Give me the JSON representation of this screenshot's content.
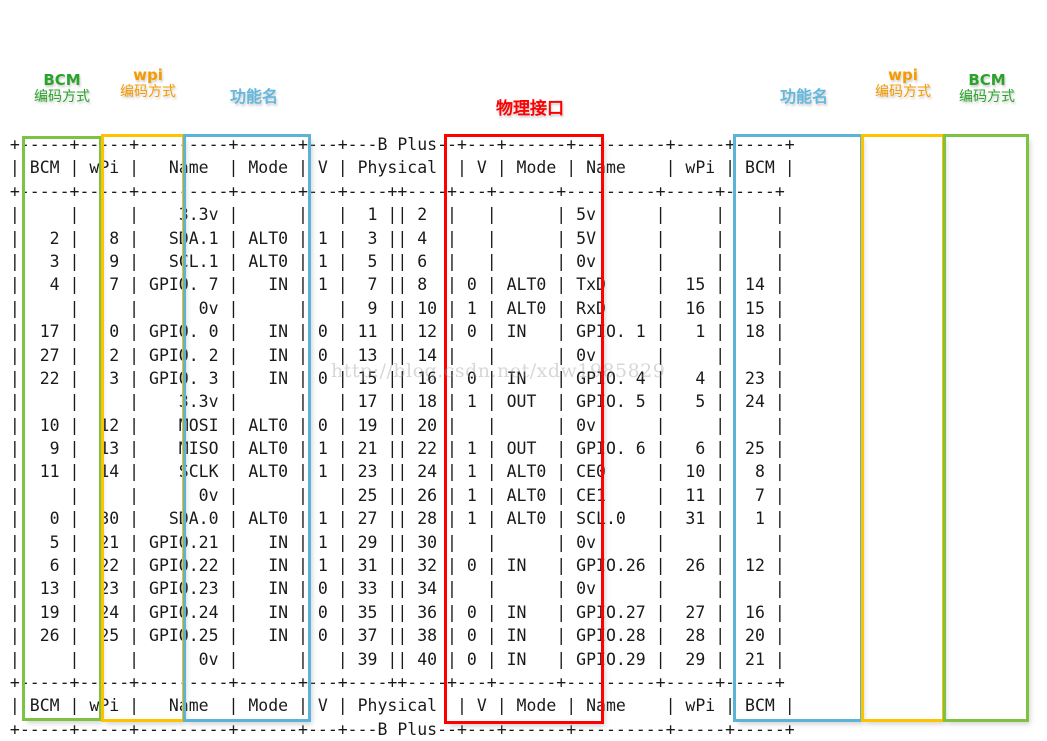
{
  "annotations": {
    "bcm_left": {
      "title": "BCM",
      "subtitle": "编码方式",
      "color": "#2aa32a"
    },
    "wpi_left": {
      "title": "wpi",
      "subtitle": "编码方式",
      "color": "#f59b00"
    },
    "name_left": {
      "title": "功能名",
      "subtitle": "",
      "color": "#63b8de"
    },
    "physical": {
      "title": "物理接口",
      "subtitle": "",
      "color": "#ff0000"
    },
    "name_right": {
      "title": "功能名",
      "subtitle": "",
      "color": "#63b8de"
    },
    "wpi_right": {
      "title": "wpi",
      "subtitle": "编码方式",
      "color": "#f59b00"
    },
    "bcm_right": {
      "title": "BCM",
      "subtitle": "编码方式",
      "color": "#2aa32a"
    }
  },
  "watermark": "http://blog.csdn.net/xdw1985829",
  "board_label": "B Plus",
  "columns": [
    "BCM",
    "wPi",
    "Name",
    "Mode",
    "V",
    "Physical",
    "V",
    "Mode",
    "Name",
    "wPi",
    "BCM"
  ],
  "table_text": [
    " +-----+-----+---------+------+---+---B Plus--+---+------+---------+-----+-----+",
    " | BCM | wPi |   Name  | Mode | V | Physical  | V | Mode | Name    | wPi | BCM |",
    " +-----+-----+---------+------+---+----++----+---+------+---------+-----+-----+",
    " |     |     |    3.3v |      |   |  1 || 2  |   |      | 5v      |     |     |",
    " |   2 |   8 |   SDA.1 | ALT0 | 1 |  3 || 4  |   |      | 5V      |     |     |",
    " |   3 |   9 |   SCL.1 | ALT0 | 1 |  5 || 6  |   |      | 0v      |     |     |",
    " |   4 |   7 | GPIO. 7 |   IN | 1 |  7 || 8  | 0 | ALT0 | TxD     |  15 |  14 |",
    " |     |     |      0v |      |   |  9 || 10 | 1 | ALT0 | RxD     |  16 |  15 |",
    " |  17 |   0 | GPIO. 0 |   IN | 0 | 11 || 12 | 0 | IN   | GPIO. 1 |   1 |  18 |",
    " |  27 |   2 | GPIO. 2 |   IN | 0 | 13 || 14 |   |      | 0v      |     |     |",
    " |  22 |   3 | GPIO. 3 |   IN | 0 | 15 || 16 | 0 | IN   | GPIO. 4 |   4 |  23 |",
    " |     |     |    3.3v |      |   | 17 || 18 | 1 | OUT  | GPIO. 5 |   5 |  24 |",
    " |  10 |  12 |    MOSI | ALT0 | 0 | 19 || 20 |   |      | 0v      |     |     |",
    " |   9 |  13 |    MISO | ALT0 | 1 | 21 || 22 | 1 | OUT  | GPIO. 6 |   6 |  25 |",
    " |  11 |  14 |    SCLK | ALT0 | 1 | 23 || 24 | 1 | ALT0 | CE0     |  10 |   8 |",
    " |     |     |      0v |      |   | 25 || 26 | 1 | ALT0 | CE1     |  11 |   7 |",
    " |   0 |  30 |   SDA.0 | ALT0 | 1 | 27 || 28 | 1 | ALT0 | SCL.0   |  31 |   1 |",
    " |   5 |  21 | GPIO.21 |   IN | 1 | 29 || 30 |   |      | 0v      |     |     |",
    " |   6 |  22 | GPIO.22 |   IN | 1 | 31 || 32 | 0 | IN   | GPIO.26 |  26 |  12 |",
    " |  13 |  23 | GPIO.23 |   IN | 0 | 33 || 34 |   |      | 0v      |     |     |",
    " |  19 |  24 | GPIO.24 |   IN | 0 | 35 || 36 | 0 | IN   | GPIO.27 |  27 |  16 |",
    " |  26 |  25 | GPIO.25 |   IN | 0 | 37 || 38 | 0 | IN   | GPIO.28 |  28 |  20 |",
    " |     |     |      0v |      |   | 39 || 40 | 0 | IN   | GPIO.29 |  29 |  21 |",
    " +-----+-----+---------+------+---+----++----+---+------+---------+-----+-----+",
    " | BCM | wPi |   Name  | Mode | V | Physical  | V | Mode | Name    | wPi | BCM |",
    " +-----+-----+---------+------+---+---B Plus--+---+------+---------+-----+-----+"
  ],
  "rows": [
    {
      "bcm_l": "",
      "wpi_l": "",
      "name_l": "3.3v",
      "mode_l": "",
      "v_l": "",
      "phys_l": "1",
      "phys_r": "2",
      "v_r": "",
      "mode_r": "",
      "name_r": "5v",
      "wpi_r": "",
      "bcm_r": ""
    },
    {
      "bcm_l": "2",
      "wpi_l": "8",
      "name_l": "SDA.1",
      "mode_l": "ALT0",
      "v_l": "1",
      "phys_l": "3",
      "phys_r": "4",
      "v_r": "",
      "mode_r": "",
      "name_r": "5V",
      "wpi_r": "",
      "bcm_r": ""
    },
    {
      "bcm_l": "3",
      "wpi_l": "9",
      "name_l": "SCL.1",
      "mode_l": "ALT0",
      "v_l": "1",
      "phys_l": "5",
      "phys_r": "6",
      "v_r": "",
      "mode_r": "",
      "name_r": "0v",
      "wpi_r": "",
      "bcm_r": ""
    },
    {
      "bcm_l": "4",
      "wpi_l": "7",
      "name_l": "GPIO. 7",
      "mode_l": "IN",
      "v_l": "1",
      "phys_l": "7",
      "phys_r": "8",
      "v_r": "0",
      "mode_r": "ALT0",
      "name_r": "TxD",
      "wpi_r": "15",
      "bcm_r": "14"
    },
    {
      "bcm_l": "",
      "wpi_l": "",
      "name_l": "0v",
      "mode_l": "",
      "v_l": "",
      "phys_l": "9",
      "phys_r": "10",
      "v_r": "1",
      "mode_r": "ALT0",
      "name_r": "RxD",
      "wpi_r": "16",
      "bcm_r": "15"
    },
    {
      "bcm_l": "17",
      "wpi_l": "0",
      "name_l": "GPIO. 0",
      "mode_l": "IN",
      "v_l": "0",
      "phys_l": "11",
      "phys_r": "12",
      "v_r": "0",
      "mode_r": "IN",
      "name_r": "GPIO. 1",
      "wpi_r": "1",
      "bcm_r": "18"
    },
    {
      "bcm_l": "27",
      "wpi_l": "2",
      "name_l": "GPIO. 2",
      "mode_l": "IN",
      "v_l": "0",
      "phys_l": "13",
      "phys_r": "14",
      "v_r": "",
      "mode_r": "",
      "name_r": "0v",
      "wpi_r": "",
      "bcm_r": ""
    },
    {
      "bcm_l": "22",
      "wpi_l": "3",
      "name_l": "GPIO. 3",
      "mode_l": "IN",
      "v_l": "0",
      "phys_l": "15",
      "phys_r": "16",
      "v_r": "0",
      "mode_r": "IN",
      "name_r": "GPIO. 4",
      "wpi_r": "4",
      "bcm_r": "23"
    },
    {
      "bcm_l": "",
      "wpi_l": "",
      "name_l": "3.3v",
      "mode_l": "",
      "v_l": "",
      "phys_l": "17",
      "phys_r": "18",
      "v_r": "1",
      "mode_r": "OUT",
      "name_r": "GPIO. 5",
      "wpi_r": "5",
      "bcm_r": "24"
    },
    {
      "bcm_l": "10",
      "wpi_l": "12",
      "name_l": "MOSI",
      "mode_l": "ALT0",
      "v_l": "0",
      "phys_l": "19",
      "phys_r": "20",
      "v_r": "",
      "mode_r": "",
      "name_r": "0v",
      "wpi_r": "",
      "bcm_r": ""
    },
    {
      "bcm_l": "9",
      "wpi_l": "13",
      "name_l": "MISO",
      "mode_l": "ALT0",
      "v_l": "1",
      "phys_l": "21",
      "phys_r": "22",
      "v_r": "1",
      "mode_r": "OUT",
      "name_r": "GPIO. 6",
      "wpi_r": "6",
      "bcm_r": "25"
    },
    {
      "bcm_l": "11",
      "wpi_l": "14",
      "name_l": "SCLK",
      "mode_l": "ALT0",
      "v_l": "1",
      "phys_l": "23",
      "phys_r": "24",
      "v_r": "1",
      "mode_r": "ALT0",
      "name_r": "CE0",
      "wpi_r": "10",
      "bcm_r": "8"
    },
    {
      "bcm_l": "",
      "wpi_l": "",
      "name_l": "0v",
      "mode_l": "",
      "v_l": "",
      "phys_l": "25",
      "phys_r": "26",
      "v_r": "1",
      "mode_r": "ALT0",
      "name_r": "CE1",
      "wpi_r": "11",
      "bcm_r": "7"
    },
    {
      "bcm_l": "0",
      "wpi_l": "30",
      "name_l": "SDA.0",
      "mode_l": "ALT0",
      "v_l": "1",
      "phys_l": "27",
      "phys_r": "28",
      "v_r": "1",
      "mode_r": "ALT0",
      "name_r": "SCL.0",
      "wpi_r": "31",
      "bcm_r": "1"
    },
    {
      "bcm_l": "5",
      "wpi_l": "21",
      "name_l": "GPIO.21",
      "mode_l": "IN",
      "v_l": "1",
      "phys_l": "29",
      "phys_r": "30",
      "v_r": "",
      "mode_r": "",
      "name_r": "0v",
      "wpi_r": "",
      "bcm_r": ""
    },
    {
      "bcm_l": "6",
      "wpi_l": "22",
      "name_l": "GPIO.22",
      "mode_l": "IN",
      "v_l": "1",
      "phys_l": "31",
      "phys_r": "32",
      "v_r": "0",
      "mode_r": "IN",
      "name_r": "GPIO.26",
      "wpi_r": "26",
      "bcm_r": "12"
    },
    {
      "bcm_l": "13",
      "wpi_l": "23",
      "name_l": "GPIO.23",
      "mode_l": "IN",
      "v_l": "0",
      "phys_l": "33",
      "phys_r": "34",
      "v_r": "",
      "mode_r": "",
      "name_r": "0v",
      "wpi_r": "",
      "bcm_r": ""
    },
    {
      "bcm_l": "19",
      "wpi_l": "24",
      "name_l": "GPIO.24",
      "mode_l": "IN",
      "v_l": "0",
      "phys_l": "35",
      "phys_r": "36",
      "v_r": "0",
      "mode_r": "IN",
      "name_r": "GPIO.27",
      "wpi_r": "27",
      "bcm_r": "16"
    },
    {
      "bcm_l": "26",
      "wpi_l": "25",
      "name_l": "GPIO.25",
      "mode_l": "IN",
      "v_l": "0",
      "phys_l": "37",
      "phys_r": "38",
      "v_r": "0",
      "mode_r": "IN",
      "name_r": "GPIO.28",
      "wpi_r": "28",
      "bcm_r": "20"
    },
    {
      "bcm_l": "",
      "wpi_l": "",
      "name_l": "0v",
      "mode_l": "",
      "v_l": "",
      "phys_l": "39",
      "phys_r": "40",
      "v_r": "0",
      "mode_r": "IN",
      "name_r": "GPIO.29",
      "wpi_r": "29",
      "bcm_r": "21"
    }
  ]
}
